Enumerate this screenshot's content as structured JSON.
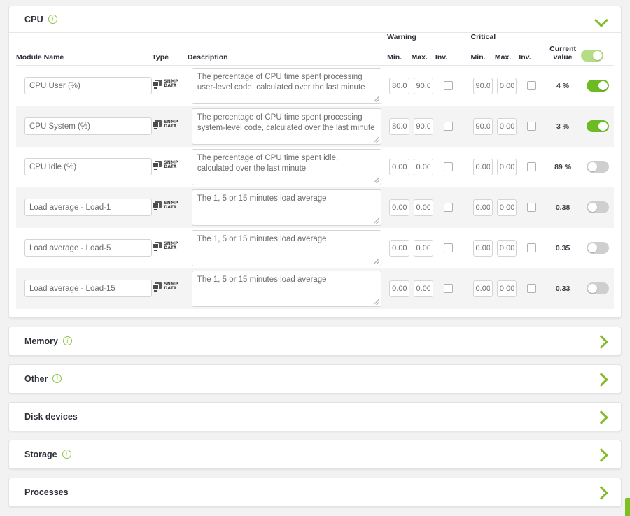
{
  "cpu_section": {
    "title": "CPU",
    "info_icon": "info-circle-icon",
    "collapse_icon": "chevron-down-icon",
    "expanded": true,
    "master_toggle": "on-light",
    "columns": {
      "module_name": "Module Name",
      "type": "Type",
      "description": "Description",
      "warning": "Warning",
      "critical": "Critical",
      "min": "Min.",
      "max": "Max.",
      "inv": "Inv.",
      "current_value_line1": "Current",
      "current_value_line2": "value"
    },
    "rows": [
      {
        "name": "CPU User (%)",
        "type_icon": "snmp-data-icon",
        "type_label_line1": "SNMP",
        "type_label_line2": "DATA",
        "description": "The percentage of CPU time spent processing user-level code, calculated over the last minute",
        "warning_min": "80.00",
        "warning_max": "90.00",
        "warning_inv": false,
        "critical_min": "90.00",
        "critical_max": "0.00",
        "critical_inv": false,
        "current_value": "4 %",
        "enabled": true
      },
      {
        "name": "CPU System (%)",
        "type_icon": "snmp-data-icon",
        "type_label_line1": "SNMP",
        "type_label_line2": "DATA",
        "description": "The percentage of CPU time spent processing system-level code, calculated over the last minute",
        "warning_min": "80.00",
        "warning_max": "90.00",
        "warning_inv": false,
        "critical_min": "90.00",
        "critical_max": "0.00",
        "critical_inv": false,
        "current_value": "3 %",
        "enabled": true
      },
      {
        "name": "CPU Idle (%)",
        "type_icon": "snmp-data-icon",
        "type_label_line1": "SNMP",
        "type_label_line2": "DATA",
        "description": "The percentage of CPU time spent idle, calculated over the last minute",
        "warning_min": "0.00",
        "warning_max": "0.00",
        "warning_inv": false,
        "critical_min": "0.00",
        "critical_max": "0.00",
        "critical_inv": false,
        "current_value": "89 %",
        "enabled": false
      },
      {
        "name": "Load average - Load-1",
        "type_icon": "snmp-data-icon",
        "type_label_line1": "SNMP",
        "type_label_line2": "DATA",
        "description": "The 1, 5 or 15 minutes load average",
        "warning_min": "0.00",
        "warning_max": "0.00",
        "warning_inv": false,
        "critical_min": "0.00",
        "critical_max": "0.00",
        "critical_inv": false,
        "current_value": "0.38",
        "enabled": false
      },
      {
        "name": "Load average - Load-5",
        "type_icon": "snmp-data-icon",
        "type_label_line1": "SNMP",
        "type_label_line2": "DATA",
        "description": "The 1, 5 or 15 minutes load average",
        "warning_min": "0.00",
        "warning_max": "0.00",
        "warning_inv": false,
        "critical_min": "0.00",
        "critical_max": "0.00",
        "critical_inv": false,
        "current_value": "0.35",
        "enabled": false
      },
      {
        "name": "Load average - Load-15",
        "type_icon": "snmp-data-icon",
        "type_label_line1": "SNMP",
        "type_label_line2": "DATA",
        "description": "The 1, 5 or 15 minutes load average",
        "warning_min": "0.00",
        "warning_max": "0.00",
        "warning_inv": false,
        "critical_min": "0.00",
        "critical_max": "0.00",
        "critical_inv": false,
        "current_value": "0.33",
        "enabled": false
      }
    ]
  },
  "collapsed_sections": [
    {
      "title": "Memory",
      "has_info": true,
      "expand_icon": "chevron-right-icon"
    },
    {
      "title": "Other",
      "has_info": true,
      "expand_icon": "chevron-right-icon"
    },
    {
      "title": "Disk devices",
      "has_info": false,
      "expand_icon": "chevron-right-icon"
    },
    {
      "title": "Storage",
      "has_info": true,
      "expand_icon": "chevron-right-icon"
    },
    {
      "title": "Processes",
      "has_info": false,
      "expand_icon": "chevron-right-icon"
    }
  ],
  "colors": {
    "accent_green": "#7cc11f",
    "toggle_on": "#6dbb23",
    "toggle_on_light": "#b4dd86",
    "toggle_off": "#cfcfcf",
    "page_background": "#f2f2f2",
    "panel_background": "#ffffff",
    "row_alt_background": "#f4f4f4",
    "text_dark": "#2b2f38",
    "input_text": "#6d6d6d"
  }
}
